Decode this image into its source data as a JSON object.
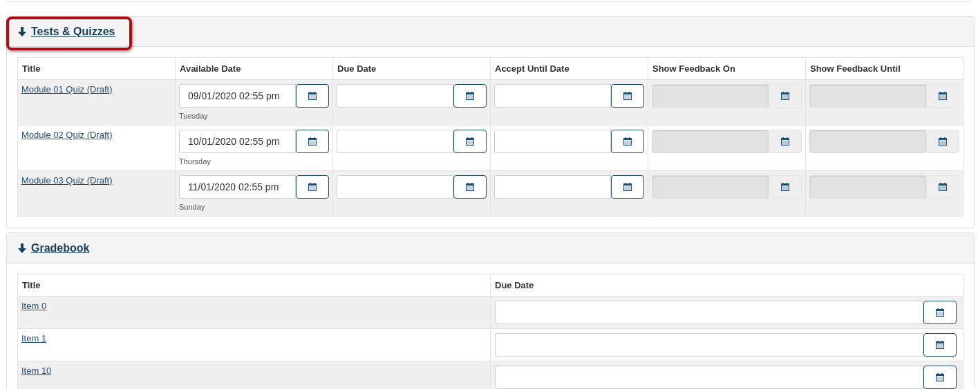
{
  "sections": [
    {
      "title": "Tests & Quizzes",
      "highlighted": true,
      "columns": [
        "Title",
        "Available Date",
        "Due Date",
        "Accept Until Date",
        "Show Feedback On",
        "Show Feedback Until"
      ],
      "rows": [
        {
          "title": "Module 01 Quiz (Draft)",
          "dates": [
            {
              "value": "09/01/2020 02:55 pm",
              "note": "Tuesday",
              "disabled": false
            },
            {
              "disabled": false
            },
            {
              "disabled": false
            },
            {
              "disabled": true
            },
            {
              "disabled": true
            }
          ]
        },
        {
          "title": "Module 02 Quiz (Draft)",
          "dates": [
            {
              "value": "10/01/2020 02:55 pm",
              "note": "Thursday",
              "disabled": false
            },
            {
              "disabled": false
            },
            {
              "disabled": false
            },
            {
              "disabled": true
            },
            {
              "disabled": true
            }
          ]
        },
        {
          "title": "Module 03 Quiz (Draft)",
          "dates": [
            {
              "value": "11/01/2020 02:55 pm",
              "note": "Sunday",
              "disabled": false
            },
            {
              "disabled": false
            },
            {
              "disabled": false
            },
            {
              "disabled": true
            },
            {
              "disabled": true
            }
          ]
        }
      ]
    },
    {
      "title": "Gradebook",
      "highlighted": false,
      "columns": [
        "Title",
        "Due Date"
      ],
      "rows": [
        {
          "title": "Item 0",
          "dates": [
            {
              "disabled": false
            }
          ]
        },
        {
          "title": "Item 1",
          "dates": [
            {
              "disabled": false
            }
          ]
        },
        {
          "title": "Item 10",
          "dates": [
            {
              "disabled": false
            }
          ]
        }
      ]
    }
  ]
}
